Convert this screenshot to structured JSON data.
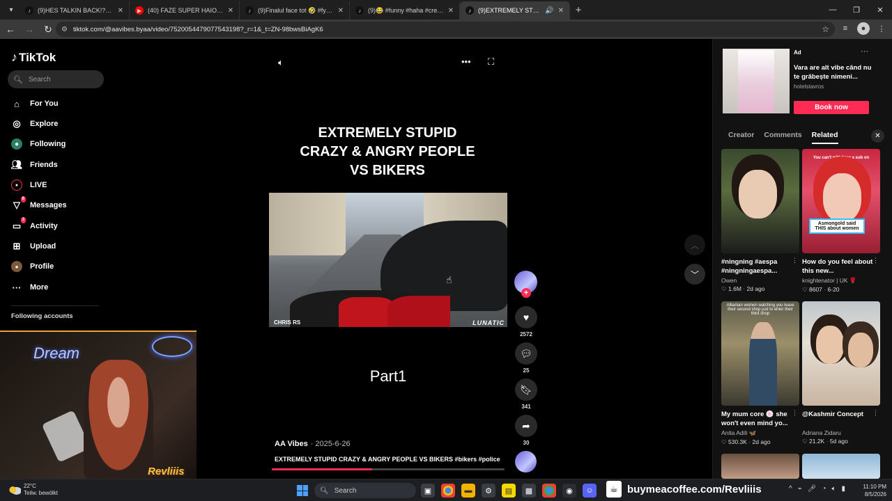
{
  "browser": {
    "tabs": [
      {
        "title": "(9)HES TALKIN BACK!?!?. . . . .",
        "icon_color": "#111111",
        "icon": "tiktok-icon"
      },
      {
        "title": "(40) FAZE SUPER HAIOASE - Yo",
        "icon_color": "#ff0000",
        "icon": "youtube-icon"
      },
      {
        "title": "(9)Finalul face tot 🤣 #fyp #vin",
        "icon_color": "#111111",
        "icon": "tiktok-icon"
      },
      {
        "title": "(9)😂 #funny #haha #creasyfor",
        "icon_color": "#111111",
        "icon": "tiktok-icon"
      },
      {
        "title": "(9)EXTREMELY STUPID CRA",
        "icon_color": "#111111",
        "icon": "tiktok-icon",
        "active": true
      }
    ],
    "url": "tiktok.com/@aavibes.byaa/video/7520054479077543198?_r=1&_t=ZN-98bwsBiAgK6"
  },
  "sidebar": {
    "logo": "TikTok",
    "search_placeholder": "Search",
    "items": [
      {
        "label": "For You",
        "icon": "home-icon"
      },
      {
        "label": "Explore",
        "icon": "compass-icon"
      },
      {
        "label": "Following",
        "icon": "following-icon"
      },
      {
        "label": "Friends",
        "icon": "friends-icon"
      },
      {
        "label": "LIVE",
        "icon": "live-icon"
      },
      {
        "label": "Messages",
        "icon": "messages-icon",
        "badge": "6"
      },
      {
        "label": "Activity",
        "icon": "activity-icon",
        "badge": "3"
      },
      {
        "label": "Upload",
        "icon": "upload-icon"
      },
      {
        "label": "Profile",
        "icon": "profile-icon"
      },
      {
        "label": "More",
        "icon": "more-icon"
      }
    ],
    "following_accounts_heading": "Following accounts"
  },
  "webcam": {
    "streamer_name": "Revliiis",
    "neon_sign": "Dream"
  },
  "video": {
    "title": "EXTREMELY STUPID\nCRAZY & ANGRY PEOPLE\nVS BIKERS",
    "frame_caption_left": "CHRIS RS",
    "frame_caption_right": "LUNATIC",
    "part_label": "Part1",
    "author": "AA Vibes",
    "date": "· 2025-6-26",
    "description": "EXTREMELY STUPID CRAZY & ANGRY PEOPLE VS BIKERS #bikers #police",
    "progress": 0.43
  },
  "actions": {
    "likes": "2572",
    "comments": "25",
    "saves": "341",
    "shares": "30"
  },
  "ad": {
    "tag": "Ad",
    "title": "Vara are alt vibe când nu te grăbește nimeni...",
    "handle": "hotelstavros",
    "button": "Book now"
  },
  "right_tabs": [
    "Creator",
    "Comments",
    "Related"
  ],
  "related": [
    {
      "title": "#ningning #aespa #ningningaespa...",
      "author": "Owen",
      "likes": "1.6M",
      "ago": "2d ago"
    },
    {
      "title": "How do you feel about this new...",
      "author": "knightenator | UK 🌹",
      "likes": "8607",
      "ago": "6-20",
      "thumb_top": "You can't withdraw a sub on twitch btw!!!",
      "thumb_caption": "Asmongold said THIS about women"
    },
    {
      "title": "My mum core 🍥 she won't even mind yo...",
      "author": "Anita Adili 🦋",
      "likes": "530.3K",
      "ago": "2d ago",
      "thumb_top": "Albanian women watching you leave their second shop just to enter their third shop"
    },
    {
      "title": "@Kashmir Concept",
      "author": "Adriana Zidaru",
      "likes": "21.2K",
      "ago": "5d ago"
    }
  ],
  "taskbar": {
    "temp": "22°C",
    "weather": "Teilw. bewölkt",
    "search": "Search",
    "promo": "buymeacoffee.com/Revliiis",
    "time": "11:10 PM",
    "date": "8/5/2026"
  }
}
